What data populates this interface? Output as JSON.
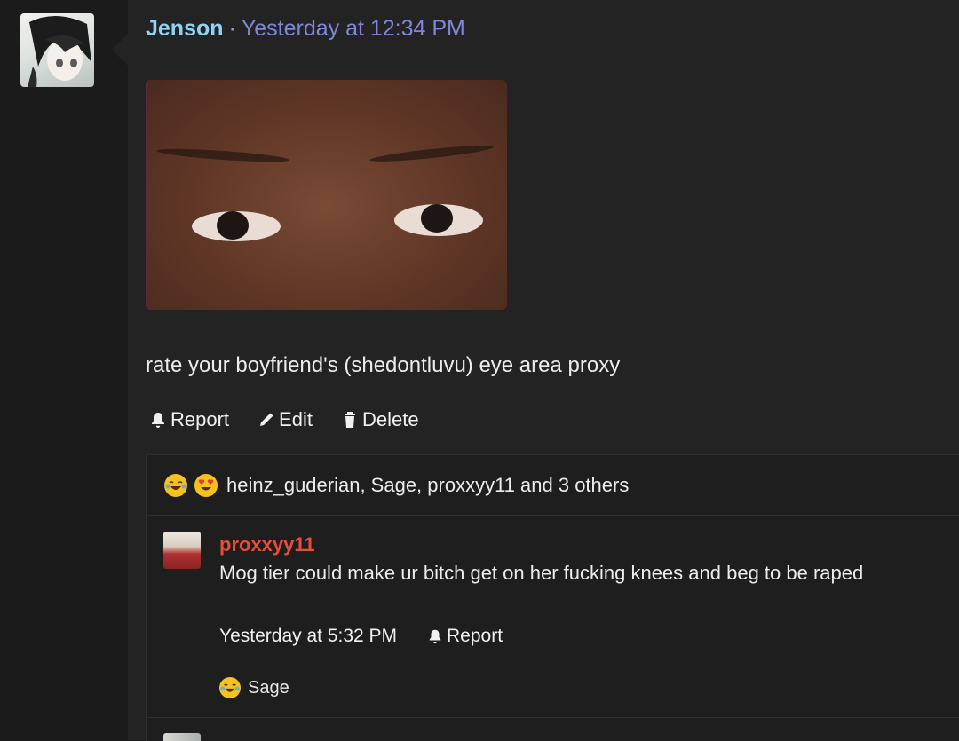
{
  "post": {
    "author": "Jenson",
    "separator": "·",
    "timestamp": "Yesterday at 12:34 PM",
    "body": "rate your boyfriend's (shedontluvu) eye area proxy",
    "actions": {
      "report": "Report",
      "edit": "Edit",
      "delete": "Delete"
    },
    "reactions": {
      "icons": [
        "crying-laughing-emoji",
        "heart-eyes-emoji"
      ],
      "text": "heinz_guderian, Sage, proxxyy11 and 3 others"
    }
  },
  "comment": {
    "author": "proxxyy11",
    "body": "Mog tier could make ur bitch get on her fucking knees and beg to be raped",
    "timestamp": "Yesterday at 5:32 PM",
    "report": "Report",
    "reaction_icon": "crying-laughing-emoji",
    "reaction_user": "Sage"
  },
  "colors": {
    "author": "#8fd3f4",
    "timestamp": "#7d88d8",
    "comment_author": "#e74c3c",
    "background": "#232323"
  }
}
